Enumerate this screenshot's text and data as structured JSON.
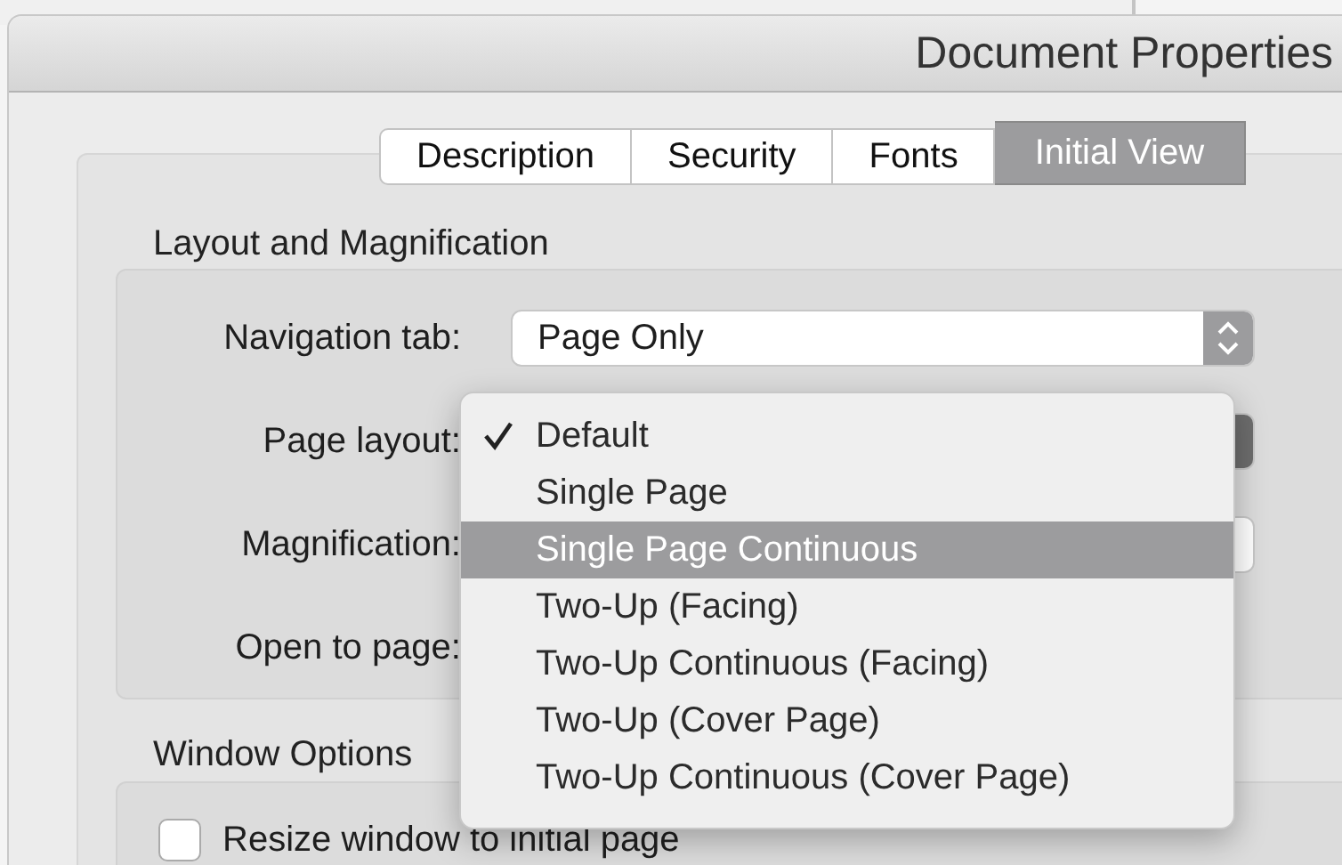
{
  "window": {
    "title": "Document Properties"
  },
  "tabs": [
    {
      "label": "Description",
      "selected": false
    },
    {
      "label": "Security",
      "selected": false
    },
    {
      "label": "Fonts",
      "selected": false
    },
    {
      "label": "Initial View",
      "selected": true
    }
  ],
  "layout_section": {
    "title": "Layout and Magnification",
    "navigation_tab": {
      "label": "Navigation tab:",
      "value": "Page Only"
    },
    "page_layout": {
      "label": "Page layout:"
    },
    "magnification": {
      "label": "Magnification:"
    },
    "open_to_page": {
      "label": "Open to page:"
    }
  },
  "page_layout_menu": {
    "items": [
      {
        "label": "Default",
        "checked": true,
        "selected": false
      },
      {
        "label": "Single Page",
        "checked": false,
        "selected": false
      },
      {
        "label": "Single Page Continuous",
        "checked": false,
        "selected": true
      },
      {
        "label": "Two-Up (Facing)",
        "checked": false,
        "selected": false
      },
      {
        "label": "Two-Up Continuous (Facing)",
        "checked": false,
        "selected": false
      },
      {
        "label": "Two-Up (Cover Page)",
        "checked": false,
        "selected": false
      },
      {
        "label": "Two-Up Continuous (Cover Page)",
        "checked": false,
        "selected": false
      }
    ]
  },
  "window_options": {
    "title": "Window Options",
    "resize_checkbox": {
      "label": "Resize window to initial page",
      "checked": false
    }
  }
}
